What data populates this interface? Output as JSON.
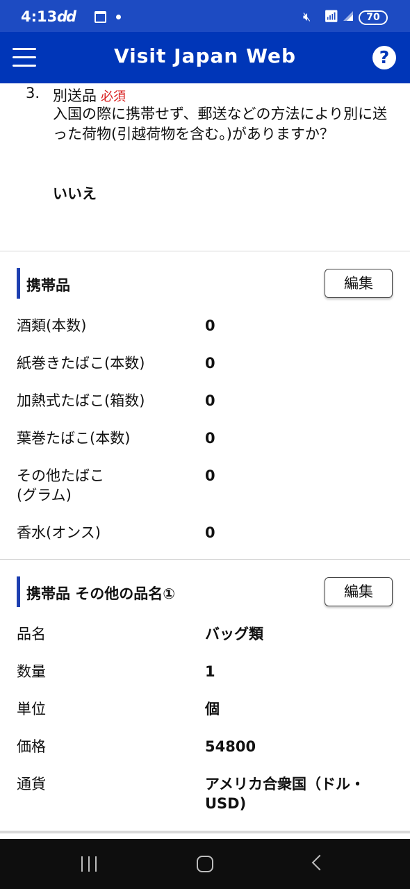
{
  "status_bar": {
    "time": "4:13",
    "carrier_icons": "dd",
    "battery_level": "70"
  },
  "app_bar": {
    "title": "Visit Japan Web",
    "help_label": "?"
  },
  "question3": {
    "number": "3.",
    "title": "別送品",
    "required": "必須",
    "body": "入国の際に携帯せず、郵送などの方法により別に送った荷物(引越荷物を含む。)がありますか？",
    "answer": "いいえ"
  },
  "carried_items": {
    "title": "携帯品",
    "edit_label": "編集",
    "rows": [
      {
        "label": "酒類(本数)",
        "value": "0"
      },
      {
        "label": "紙巻きたばこ(本数)",
        "value": "0"
      },
      {
        "label": "加熱式たばこ(箱数)",
        "value": "0"
      },
      {
        "label": "葉巻たばこ(本数)",
        "value": "0"
      },
      {
        "label": "その他たばこ\n(グラム)",
        "value": "0"
      },
      {
        "label": "香水(オンス)",
        "value": "0"
      }
    ]
  },
  "other_items": {
    "title": "携帯品 その他の品名①",
    "edit_label": "編集",
    "rows": [
      {
        "label": "品名",
        "value": "バッグ類"
      },
      {
        "label": "数量",
        "value": "1"
      },
      {
        "label": "単位",
        "value": "個"
      },
      {
        "label": "価格",
        "value": "54800"
      },
      {
        "label": "通貨",
        "value": "アメリカ合衆国（ドル・USD)"
      }
    ]
  },
  "colors": {
    "app_bar": "#0036b8",
    "status_bar": "#1d4bc2",
    "accent_bar": "#1d3fb0",
    "required": "#d81e1e"
  }
}
